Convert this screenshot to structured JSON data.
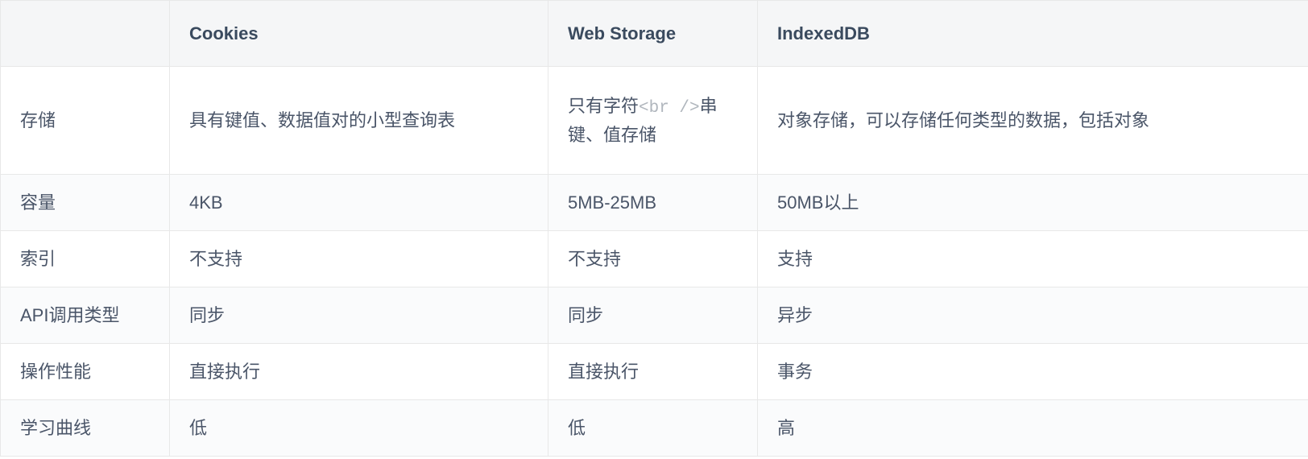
{
  "chart_data": {
    "type": "table",
    "headers": [
      "",
      "Cookies",
      "Web Storage",
      "IndexedDB"
    ],
    "rows": [
      {
        "label": "存储",
        "cookies": "具有键值、数据值对的小型查询表",
        "web_storage_pre": "只有字符",
        "web_storage_code": "<br />",
        "web_storage_post": "串键、值存储",
        "indexeddb": "对象存储，可以存储任何类型的数据，包括对象"
      },
      {
        "label": "容量",
        "cookies": "4KB",
        "web_storage": "5MB-25MB",
        "indexeddb": "50MB以上"
      },
      {
        "label": "索引",
        "cookies": "不支持",
        "web_storage": "不支持",
        "indexeddb": "支持"
      },
      {
        "label": "API调用类型",
        "cookies": "同步",
        "web_storage": "同步",
        "indexeddb": "异步"
      },
      {
        "label": "操作性能",
        "cookies": "直接执行",
        "web_storage": "直接执行",
        "indexeddb": "事务"
      },
      {
        "label": "学习曲线",
        "cookies": "低",
        "web_storage": "低",
        "indexeddb": "高"
      }
    ]
  }
}
